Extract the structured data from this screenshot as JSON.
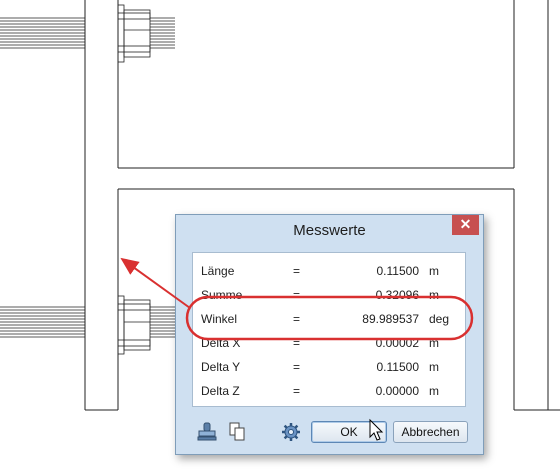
{
  "dialog": {
    "title": "Messwerte",
    "close_glyph": "✕",
    "rows": [
      {
        "label": "Länge",
        "eq": "=",
        "value": "0.11500",
        "unit": "m"
      },
      {
        "label": "Summe",
        "eq": "=",
        "value": "0.32096",
        "unit": "m"
      },
      {
        "label": "Winkel",
        "eq": "=",
        "value": "89.989537",
        "unit": "deg"
      },
      {
        "label": "Delta X",
        "eq": "=",
        "value": "0.00002",
        "unit": "m"
      },
      {
        "label": "Delta Y",
        "eq": "=",
        "value": "0.11500",
        "unit": "m"
      },
      {
        "label": "Delta Z",
        "eq": "=",
        "value": "0.00000",
        "unit": "m"
      }
    ],
    "ok_label": "OK",
    "cancel_label": "Abbrechen",
    "icons": [
      "stamp-icon",
      "copy-icon",
      "gear-icon"
    ]
  },
  "colors": {
    "highlight": "#d93030",
    "arrow": "#d93030",
    "dialog_bg": "#cfe0f1",
    "close_button": "#c75050"
  }
}
